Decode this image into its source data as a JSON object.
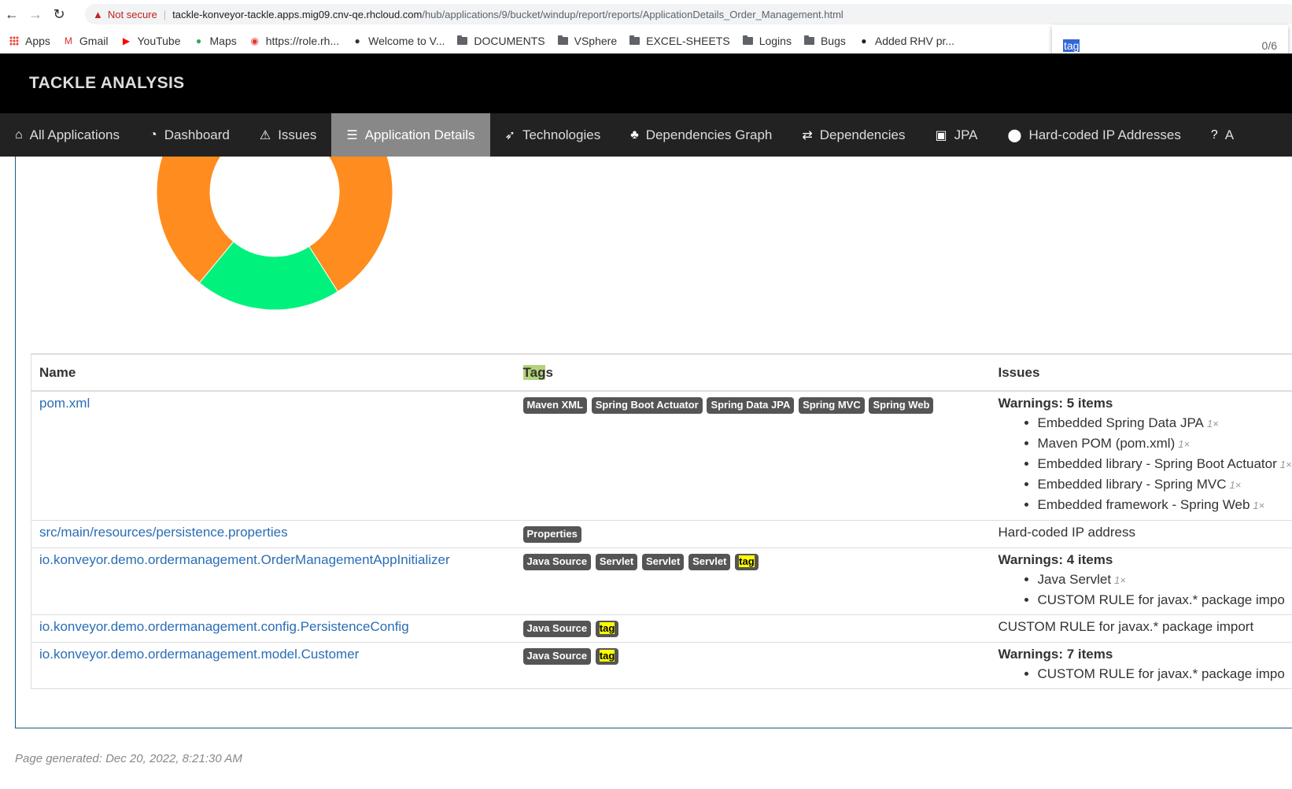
{
  "browser": {
    "not_secure": "Not secure",
    "url_host": "tackle-konveyor-tackle.apps.mig09.cnv-qe.rhcloud.com",
    "url_path": "/hub/applications/9/bucket/windup/report/reports/ApplicationDetails_Order_Management.html",
    "bookmarks": [
      {
        "label": "Apps",
        "icon": "apps-grid-icon"
      },
      {
        "label": "Gmail",
        "icon": "gmail-icon"
      },
      {
        "label": "YouTube",
        "icon": "youtube-icon"
      },
      {
        "label": "Maps",
        "icon": "maps-icon"
      },
      {
        "label": "https://role.rh...",
        "icon": "bulb-icon"
      },
      {
        "label": "Welcome to V...",
        "icon": "globe-icon"
      },
      {
        "label": "DOCUMENTS",
        "icon": "folder-icon"
      },
      {
        "label": "VSphere",
        "icon": "folder-icon"
      },
      {
        "label": "EXCEL-SHEETS",
        "icon": "folder-icon"
      },
      {
        "label": "Logins",
        "icon": "folder-icon"
      },
      {
        "label": "Bugs",
        "icon": "folder-icon"
      },
      {
        "label": "Added RHV pr...",
        "icon": "github-icon"
      }
    ],
    "find": {
      "query": "tag",
      "count": "0/6"
    }
  },
  "app": {
    "title": "TACKLE ANALYSIS",
    "nav": [
      {
        "label": "All Applications",
        "icon": "home-icon",
        "active": false
      },
      {
        "label": "Dashboard",
        "icon": "dashboard-icon",
        "active": false
      },
      {
        "label": "Issues",
        "icon": "warning-icon",
        "active": false
      },
      {
        "label": "Application Details",
        "icon": "list-icon",
        "active": true
      },
      {
        "label": "Technologies",
        "icon": "rocket-icon",
        "active": false
      },
      {
        "label": "Dependencies Graph",
        "icon": "tree-icon",
        "active": false
      },
      {
        "label": "Dependencies",
        "icon": "retweet-icon",
        "active": false
      },
      {
        "label": "JPA",
        "icon": "jpa-icon",
        "active": false
      },
      {
        "label": "Hard-coded IP Addresses",
        "icon": "map-marker-icon",
        "active": false
      },
      {
        "label": "A",
        "icon": "question-icon",
        "active": false
      }
    ]
  },
  "chart_data": {
    "type": "pie",
    "slices": [
      {
        "name": "",
        "value": 0.8,
        "color": "#ff8c1f"
      },
      {
        "name": "",
        "value": 0.2,
        "color": "#00f27c"
      }
    ],
    "title": ""
  },
  "table": {
    "headers": {
      "name": "Name",
      "tags_hl": "Tag",
      "tags_rest": "s",
      "issues": "Issues"
    },
    "rows": [
      {
        "name": "pom.xml",
        "tags": [
          "Maven XML",
          "Spring Boot Actuator",
          "Spring Data JPA",
          "Spring MVC",
          "Spring Web"
        ],
        "issues_head": "Warnings: 5 items",
        "issues": [
          {
            "text": "Embedded Spring Data JPA",
            "count": "1×"
          },
          {
            "text": "Maven POM (pom.xml)",
            "count": "1×"
          },
          {
            "text": "Embedded library - Spring Boot Actuator",
            "count": "1×"
          },
          {
            "text": "Embedded library - Spring MVC",
            "count": "1×"
          },
          {
            "text": "Embedded framework - Spring Web",
            "count": "1×"
          }
        ]
      },
      {
        "name": "src/main/resources/persistence.properties",
        "tags": [
          "Properties"
        ],
        "issues_plain": "Hard-coded IP address"
      },
      {
        "name": "io.konveyor.demo.ordermanagement.OrderManagementAppInitializer",
        "tags": [
          "Java Source",
          "Servlet",
          "Servlet",
          "Servlet",
          "tag"
        ],
        "issues_head": "Warnings: 4 items",
        "issues": [
          {
            "text": "Java Servlet",
            "count": "1×"
          },
          {
            "text": "CUSTOM RULE for javax.* package impo",
            "count": ""
          }
        ]
      },
      {
        "name": "io.konveyor.demo.ordermanagement.config.PersistenceConfig",
        "tags": [
          "Java Source",
          "tag"
        ],
        "issues_plain": "CUSTOM RULE for javax.* package import"
      },
      {
        "name": "io.konveyor.demo.ordermanagement.model.Customer",
        "tags": [
          "Java Source",
          "tag"
        ],
        "issues_head": "Warnings: 7 items",
        "issues": [
          {
            "text": "CUSTOM RULE for javax.* package impo",
            "count": ""
          }
        ]
      }
    ]
  },
  "footer": {
    "generated": "Page generated: Dec 20, 2022, 8:21:30 AM"
  }
}
